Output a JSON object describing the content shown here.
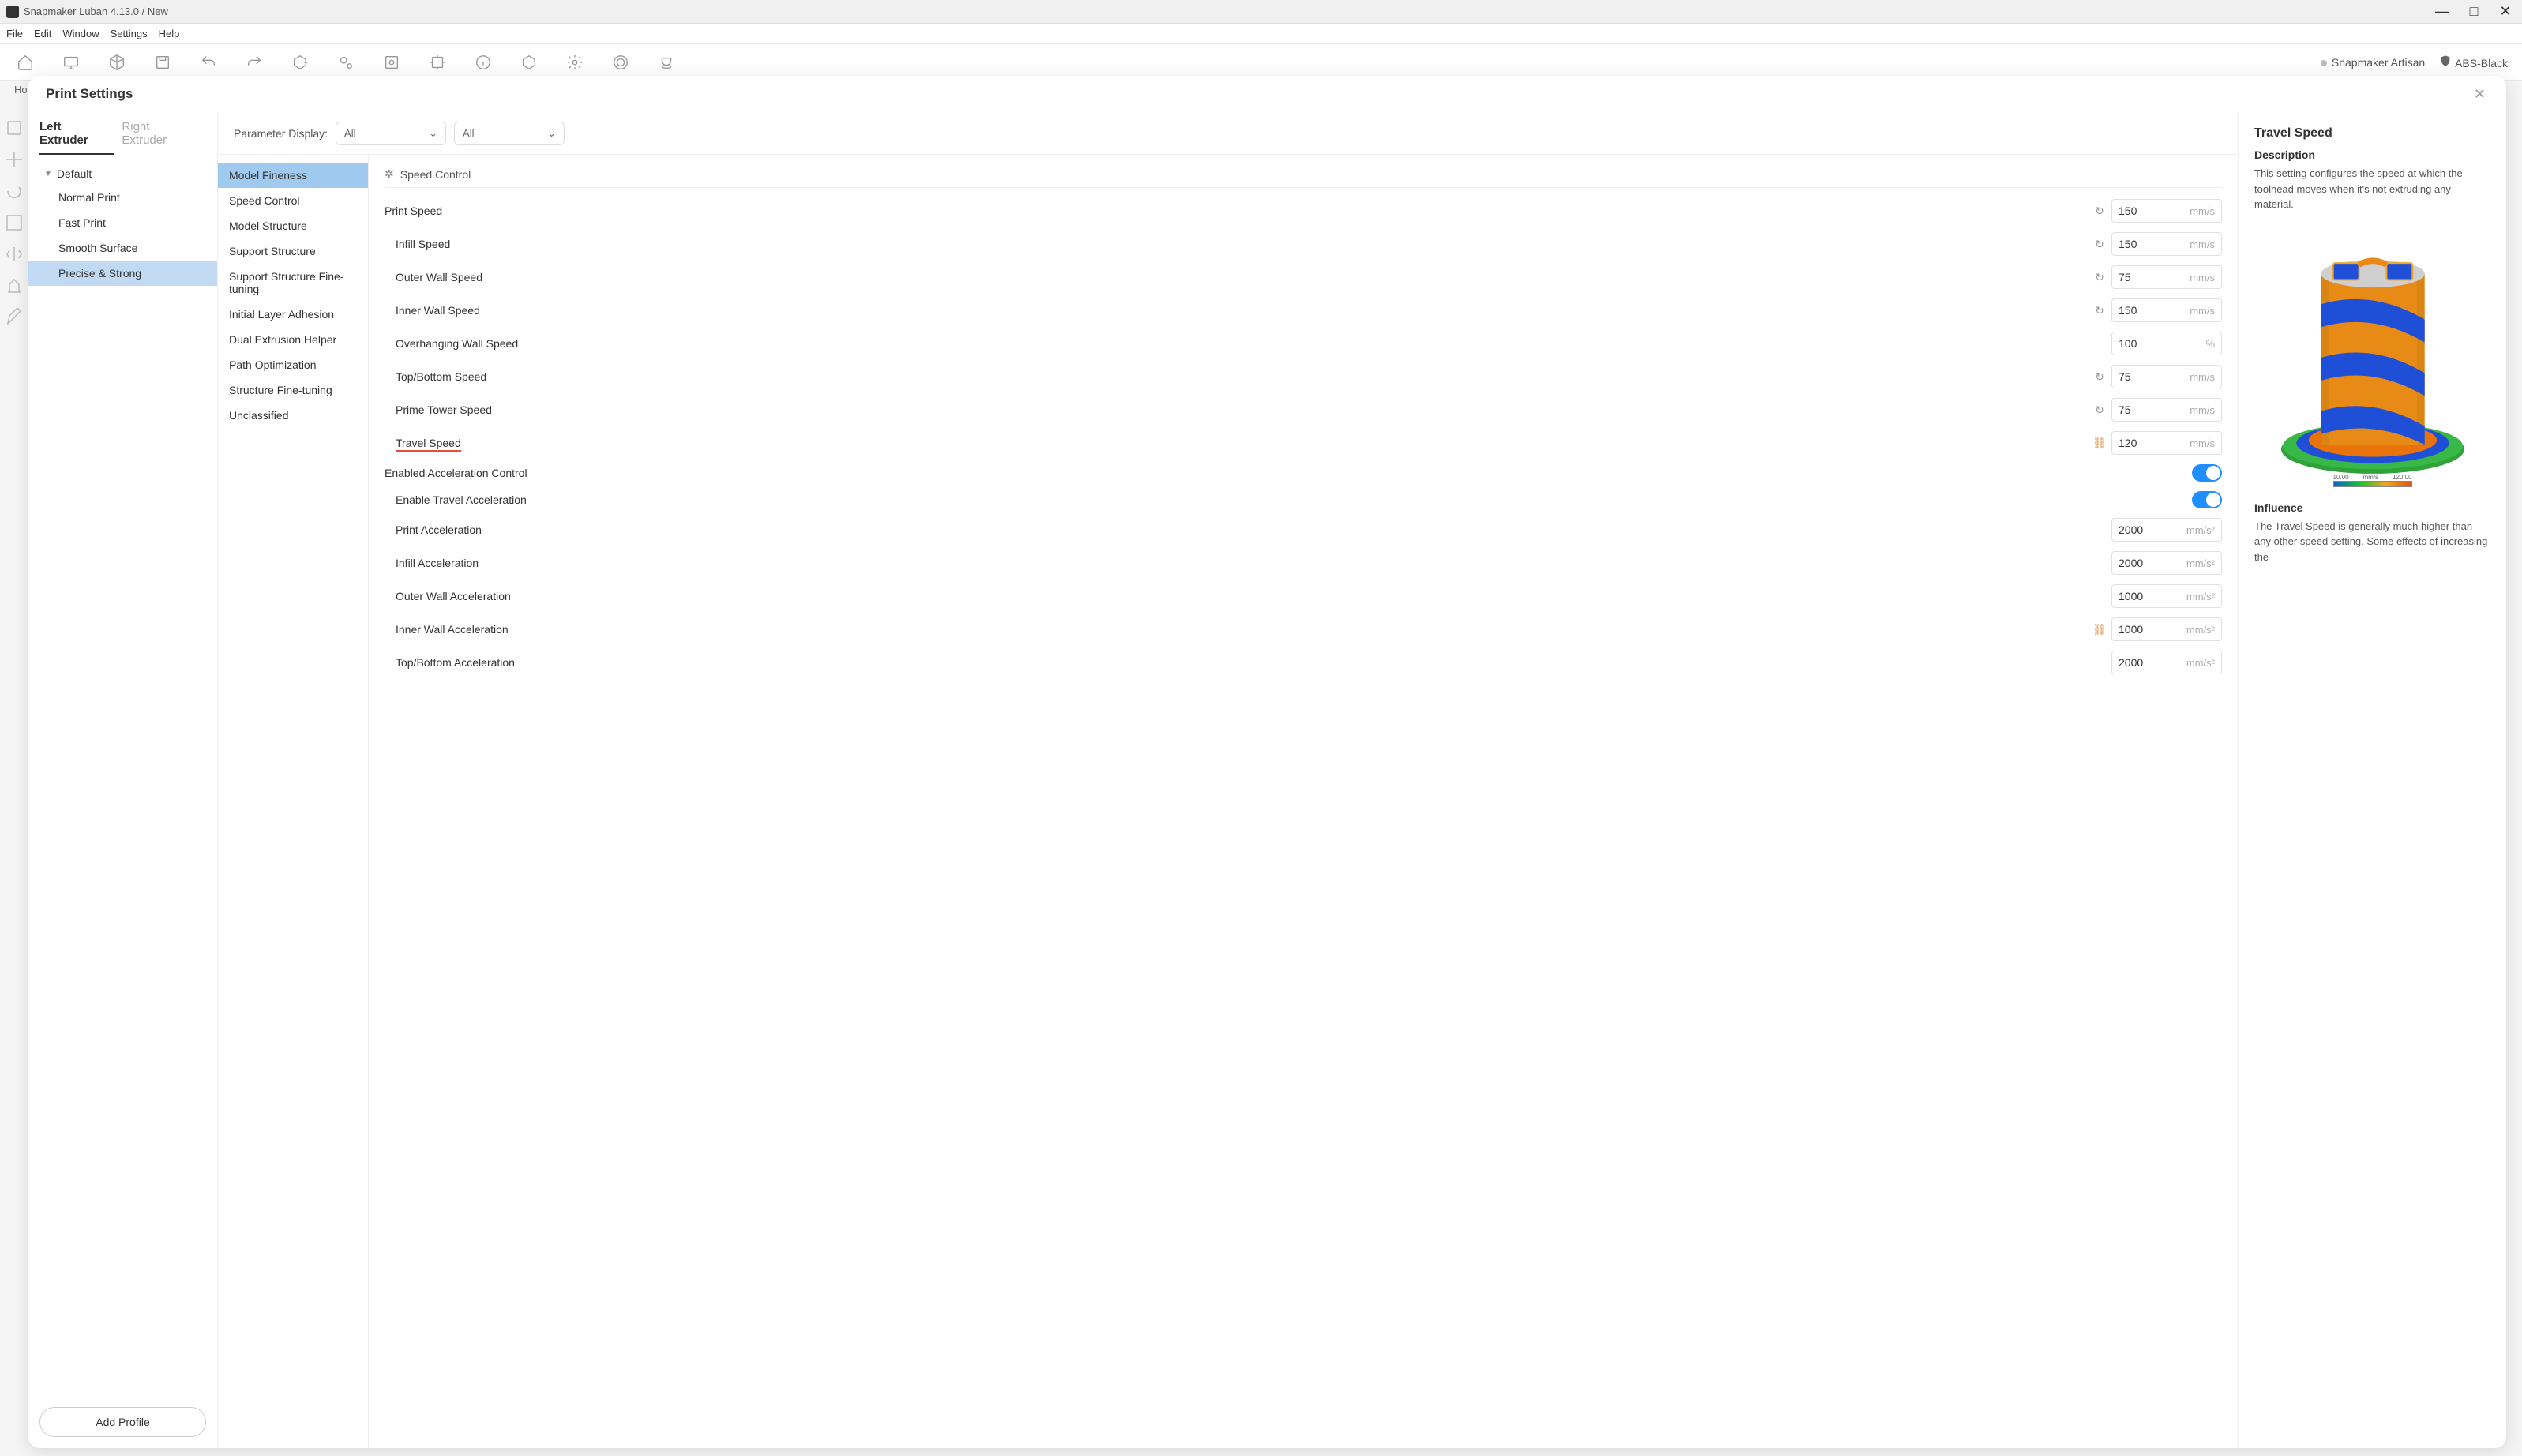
{
  "title_bar": "Snapmaker Luban 4.13.0 / New",
  "menus": [
    "File",
    "Edit",
    "Window",
    "Settings",
    "Help"
  ],
  "home_label": "Ho",
  "device_name": "Snapmaker Artisan",
  "material_name": "ABS-Black",
  "modal": {
    "title": "Print Settings",
    "extruder_tabs": [
      "Left Extruder",
      "Right Extruder"
    ],
    "profile_group": "Default",
    "profiles": [
      "Normal Print",
      "Fast Print",
      "Smooth Surface",
      "Precise & Strong"
    ],
    "add_profile": "Add Profile"
  },
  "param_bar": {
    "label": "Parameter Display:",
    "select1": "All",
    "select2": "All"
  },
  "categories": [
    "Model Fineness",
    "Speed Control",
    "Model Structure",
    "Support Structure",
    "Support Structure Fine-tuning",
    "Initial Layer Adhesion",
    "Dual Extrusion Helper",
    "Path Optimization",
    "Structure Fine-tuning",
    "Unclassified"
  ],
  "section_title": "Speed Control",
  "settings": {
    "print_speed": {
      "label": "Print Speed",
      "value": "150",
      "unit": "mm/s"
    },
    "infill_speed": {
      "label": "Infill Speed",
      "value": "150",
      "unit": "mm/s"
    },
    "outer_wall_speed": {
      "label": "Outer Wall Speed",
      "value": "75",
      "unit": "mm/s"
    },
    "inner_wall_speed": {
      "label": "Inner Wall Speed",
      "value": "150",
      "unit": "mm/s"
    },
    "overhanging_wall_speed": {
      "label": "Overhanging Wall Speed",
      "value": "100",
      "unit": "%"
    },
    "top_bottom_speed": {
      "label": "Top/Bottom Speed",
      "value": "75",
      "unit": "mm/s"
    },
    "prime_tower_speed": {
      "label": "Prime Tower Speed",
      "value": "75",
      "unit": "mm/s"
    },
    "travel_speed": {
      "label": "Travel Speed",
      "value": "120",
      "unit": "mm/s"
    },
    "enabled_acc": {
      "label": "Enabled Acceleration Control"
    },
    "enable_travel_acc": {
      "label": "Enable Travel Acceleration"
    },
    "print_acc": {
      "label": "Print Acceleration",
      "value": "2000",
      "unit": "mm/s²"
    },
    "infill_acc": {
      "label": "Infill Acceleration",
      "value": "2000",
      "unit": "mm/s²"
    },
    "outer_wall_acc": {
      "label": "Outer Wall Acceleration",
      "value": "1000",
      "unit": "mm/s²"
    },
    "inner_wall_acc": {
      "label": "Inner Wall Acceleration",
      "value": "1000",
      "unit": "mm/s²"
    },
    "top_bottom_acc": {
      "label": "Top/Bottom Acceleration",
      "value": "2000",
      "unit": "mm/s²"
    }
  },
  "info": {
    "title": "Travel Speed",
    "desc_heading": "Description",
    "desc_text": "This setting configures the speed at which the toolhead moves when it's not extruding any material.",
    "influence_heading": "Influence",
    "influence_text": "The Travel Speed is generally much higher than any other speed setting. Some effects of increasing the",
    "legend_min": "10.00",
    "legend_unit": "mm/s",
    "legend_max": "120.00"
  }
}
